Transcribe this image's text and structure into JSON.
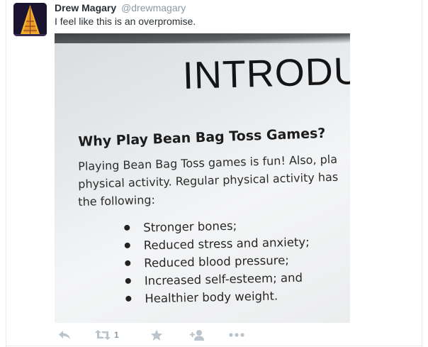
{
  "tweet": {
    "fullname": "Drew Magary",
    "username": "@drewmagary",
    "text": "I feel like this is an overpromise."
  },
  "photo": {
    "heading": "INTRODU",
    "subheading": "Why Play Bean Bag Toss Games?",
    "paragraph_lines": [
      "Playing Bean Bag Toss games is fun!  Also, pla",
      "physical activity. Regular physical activity has",
      "the following:"
    ],
    "bullets": [
      "Stronger bones;",
      "Reduced stress and anxiety;",
      "Reduced blood pressure;",
      "Increased self-esteem; and",
      "Healthier body weight."
    ]
  },
  "actions": {
    "reply_icon": "reply-icon",
    "retweet_icon": "retweet-icon",
    "retweet_count": "1",
    "favorite_icon": "star-icon",
    "follow_icon": "follow-icon",
    "more_icon": "more-icon"
  },
  "colors": {
    "name": "#292f33",
    "muted": "#8899a6",
    "icon": "#bbc4cc",
    "border": "#e6ecf0"
  }
}
